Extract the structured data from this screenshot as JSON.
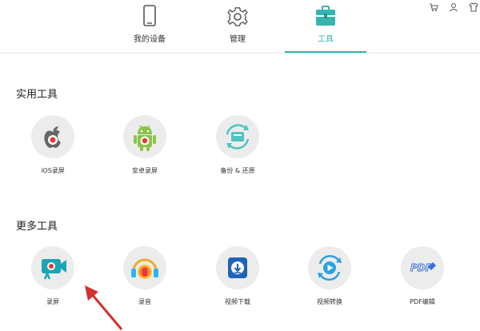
{
  "tabs": [
    {
      "label": "我的设备",
      "icon": "phone-icon"
    },
    {
      "label": "管理",
      "icon": "gear-icon"
    },
    {
      "label": "工具",
      "icon": "toolbox-icon",
      "active": true
    }
  ],
  "window_icons": [
    "cart-icon",
    "user-icon",
    "shirt-icon"
  ],
  "sections": {
    "practical": {
      "title": "实用工具",
      "tools": [
        {
          "label": "iOS录屏",
          "icon": "apple-record-icon"
        },
        {
          "label": "安卓录屏",
          "icon": "android-record-icon"
        },
        {
          "label": "备份 & 还原",
          "icon": "backup-restore-icon"
        }
      ]
    },
    "more": {
      "title": "更多工具",
      "tools": [
        {
          "label": "录屏",
          "icon": "screen-record-icon"
        },
        {
          "label": "录音",
          "icon": "audio-record-icon"
        },
        {
          "label": "视频下载",
          "icon": "video-download-icon"
        },
        {
          "label": "视频转换",
          "icon": "video-convert-icon"
        },
        {
          "label": "PDF编辑",
          "icon": "pdf-edit-icon",
          "logo_text": "PDF"
        }
      ]
    }
  },
  "colors": {
    "accent": "#36b5b0",
    "record_red": "#e53935",
    "arrow_red": "#d32f2f"
  }
}
